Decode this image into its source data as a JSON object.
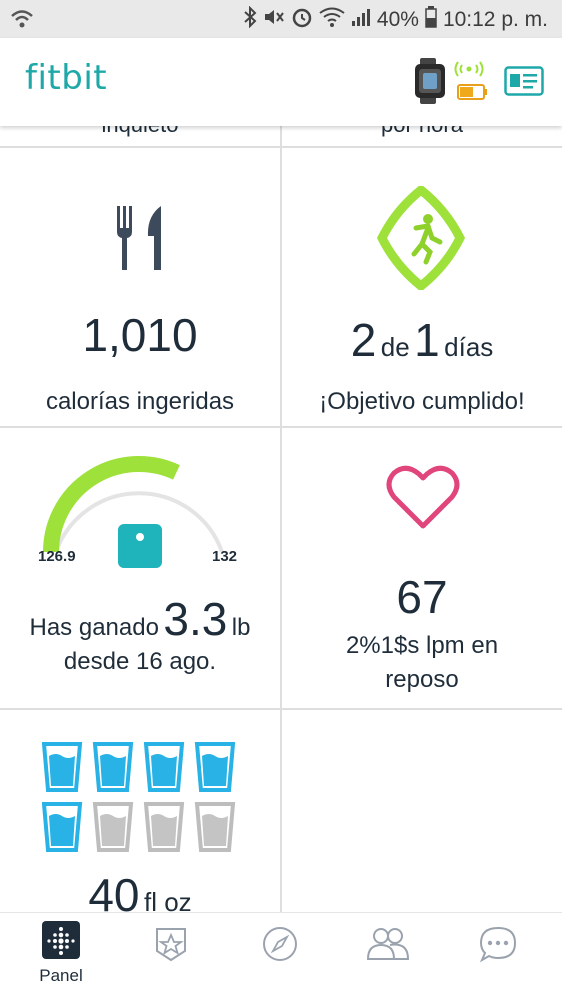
{
  "status_bar": {
    "battery": "40%",
    "time": "10:12 p. m."
  },
  "app": {
    "logo": "fitbit"
  },
  "tiles": {
    "top_left_cut": "inquieto",
    "top_right_cut": "por hora",
    "calories": {
      "value": "1,010",
      "label": "calorías ingeridas"
    },
    "exercise": {
      "num1": "2",
      "de": "de",
      "num2": "1",
      "dias": "días",
      "label": "¡Objetivo cumplido!"
    },
    "weight": {
      "gauge_min": "126.9",
      "gauge_max": "132",
      "prefix": "Has ganado",
      "value": "3.3",
      "unit": "lb",
      "since": "desde 16 ago.",
      "progress": 0.64
    },
    "heart": {
      "value": "67",
      "line1": "2%1$s lpm en",
      "line2": "reposo"
    },
    "water": {
      "value": "40",
      "unit": "fl oz",
      "filled_glasses": 5,
      "total_glasses": 8
    }
  },
  "nav": {
    "panel_label": "Panel"
  },
  "colors": {
    "teal": "#1fa8a8",
    "green": "#9ee13b",
    "pink": "#e0457b",
    "water_blue": "#29b2e6"
  }
}
